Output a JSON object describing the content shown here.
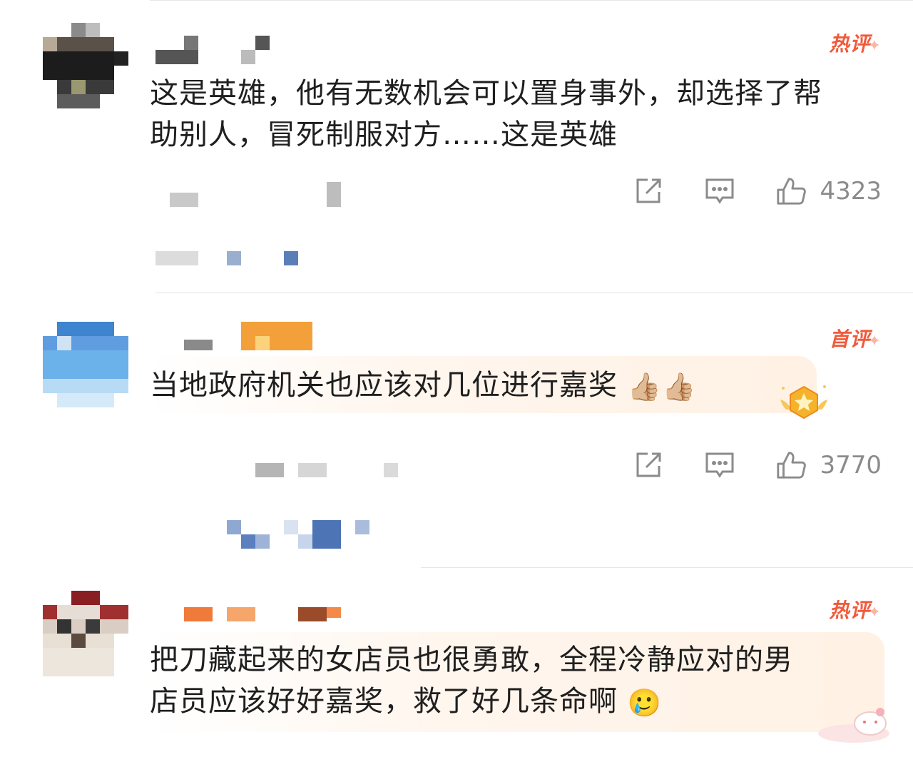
{
  "comments": [
    {
      "badge": "热评",
      "text_lines": [
        "这是英雄，他有无数机会可以置身事外，却选择了帮",
        "助别人，冒死制服对方……这是英雄"
      ],
      "likes": "4323",
      "icons": [
        "share-icon",
        "comment-icon",
        "like-icon"
      ]
    },
    {
      "badge": "首评",
      "text_lines": [
        "当地政府机关也应该对几位进行嘉奖"
      ],
      "emoji": "👍🏼👍🏼",
      "likes": "3770",
      "icons": [
        "share-icon",
        "comment-icon",
        "like-icon",
        "medal-icon"
      ]
    },
    {
      "badge": "热评",
      "text_lines": [
        "把刀藏起来的女店员也很勇敢，全程冷静应对的男",
        "店员应该好好嘉奖，救了好几条命啊"
      ],
      "emoji": "🥲",
      "icons": [
        "cat-icon"
      ]
    }
  ],
  "colors": {
    "badge": "#f05a3c",
    "count": "#8b8b8b",
    "divider": "#e6e6e6"
  }
}
